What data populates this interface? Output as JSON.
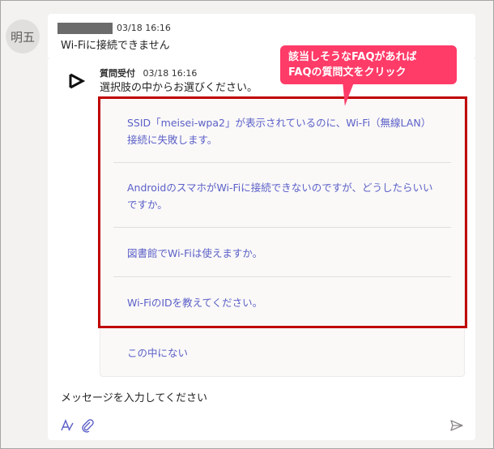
{
  "user_message": {
    "avatar_initials": "明五",
    "timestamp": "03/18 16:16",
    "text": "Wi-Fiに接続できません"
  },
  "bot_message": {
    "sender": "質問受付",
    "timestamp": "03/18 16:16",
    "prompt": "選択肢の中からお選びください。",
    "options": [
      {
        "label": "SSID「meisei-wpa2」が表示されているのに、Wi-Fi（無線LAN）接続に失敗します。"
      },
      {
        "label": "AndroidのスマホがWi-Fiに接続できないのですが、どうしたらいいですか。"
      },
      {
        "label": "図書館でWi-Fiは使えますか。"
      },
      {
        "label": "Wi-FiのIDを教えてください。"
      },
      {
        "label": "この中にない"
      }
    ]
  },
  "annotation": {
    "line1": "該当しそうなFAQがあれば",
    "line2": "FAQの質問文をクリック",
    "color": "#ff3b68",
    "box_color": "#c00000"
  },
  "compose": {
    "placeholder": "メッセージを入力してください",
    "icons": [
      "format-icon",
      "attach-icon",
      "send-icon"
    ]
  },
  "colors": {
    "link": "#5b5fc7",
    "background": "#f3f2f1"
  }
}
